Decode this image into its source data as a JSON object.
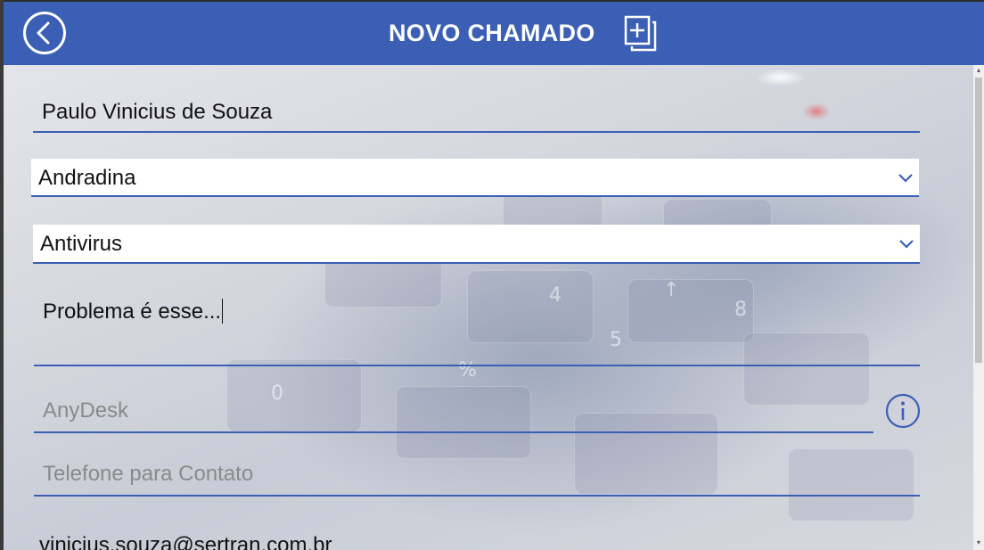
{
  "header": {
    "title": "NOVO CHAMADO",
    "back_icon": "back-arrow-circle-icon",
    "new_icon": "add-document-icon",
    "color": "#3a5fb4"
  },
  "form": {
    "name_value": "Paulo Vinicius de Souza",
    "city_selected": "Andradina",
    "category_selected": "Antivirus",
    "problem_value": "Problema é esse...",
    "anydesk_placeholder": "AnyDesk",
    "phone_placeholder": "Telefone para Contato",
    "email_value": "vinicius.souza@sertran.com.br"
  },
  "icons": {
    "chevron": "chevron-down-icon",
    "info": "info-icon"
  }
}
